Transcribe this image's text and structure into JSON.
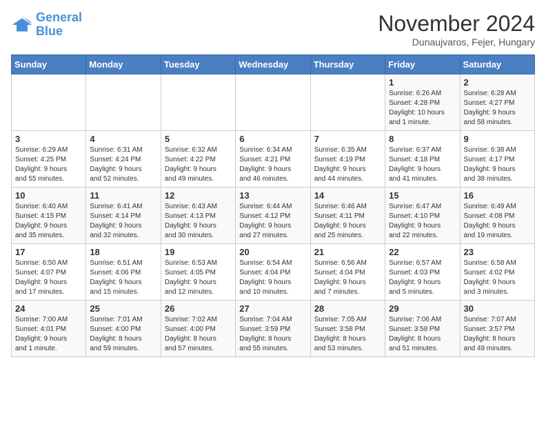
{
  "logo": {
    "line1": "General",
    "line2": "Blue"
  },
  "title": "November 2024",
  "subtitle": "Dunaujvaros, Fejer, Hungary",
  "days_header": [
    "Sunday",
    "Monday",
    "Tuesday",
    "Wednesday",
    "Thursday",
    "Friday",
    "Saturday"
  ],
  "weeks": [
    [
      {
        "day": "",
        "info": ""
      },
      {
        "day": "",
        "info": ""
      },
      {
        "day": "",
        "info": ""
      },
      {
        "day": "",
        "info": ""
      },
      {
        "day": "",
        "info": ""
      },
      {
        "day": "1",
        "info": "Sunrise: 6:26 AM\nSunset: 4:28 PM\nDaylight: 10 hours\nand 1 minute."
      },
      {
        "day": "2",
        "info": "Sunrise: 6:28 AM\nSunset: 4:27 PM\nDaylight: 9 hours\nand 58 minutes."
      }
    ],
    [
      {
        "day": "3",
        "info": "Sunrise: 6:29 AM\nSunset: 4:25 PM\nDaylight: 9 hours\nand 55 minutes."
      },
      {
        "day": "4",
        "info": "Sunrise: 6:31 AM\nSunset: 4:24 PM\nDaylight: 9 hours\nand 52 minutes."
      },
      {
        "day": "5",
        "info": "Sunrise: 6:32 AM\nSunset: 4:22 PM\nDaylight: 9 hours\nand 49 minutes."
      },
      {
        "day": "6",
        "info": "Sunrise: 6:34 AM\nSunset: 4:21 PM\nDaylight: 9 hours\nand 46 minutes."
      },
      {
        "day": "7",
        "info": "Sunrise: 6:35 AM\nSunset: 4:19 PM\nDaylight: 9 hours\nand 44 minutes."
      },
      {
        "day": "8",
        "info": "Sunrise: 6:37 AM\nSunset: 4:18 PM\nDaylight: 9 hours\nand 41 minutes."
      },
      {
        "day": "9",
        "info": "Sunrise: 6:38 AM\nSunset: 4:17 PM\nDaylight: 9 hours\nand 38 minutes."
      }
    ],
    [
      {
        "day": "10",
        "info": "Sunrise: 6:40 AM\nSunset: 4:15 PM\nDaylight: 9 hours\nand 35 minutes."
      },
      {
        "day": "11",
        "info": "Sunrise: 6:41 AM\nSunset: 4:14 PM\nDaylight: 9 hours\nand 32 minutes."
      },
      {
        "day": "12",
        "info": "Sunrise: 6:43 AM\nSunset: 4:13 PM\nDaylight: 9 hours\nand 30 minutes."
      },
      {
        "day": "13",
        "info": "Sunrise: 6:44 AM\nSunset: 4:12 PM\nDaylight: 9 hours\nand 27 minutes."
      },
      {
        "day": "14",
        "info": "Sunrise: 6:46 AM\nSunset: 4:11 PM\nDaylight: 9 hours\nand 25 minutes."
      },
      {
        "day": "15",
        "info": "Sunrise: 6:47 AM\nSunset: 4:10 PM\nDaylight: 9 hours\nand 22 minutes."
      },
      {
        "day": "16",
        "info": "Sunrise: 6:49 AM\nSunset: 4:08 PM\nDaylight: 9 hours\nand 19 minutes."
      }
    ],
    [
      {
        "day": "17",
        "info": "Sunrise: 6:50 AM\nSunset: 4:07 PM\nDaylight: 9 hours\nand 17 minutes."
      },
      {
        "day": "18",
        "info": "Sunrise: 6:51 AM\nSunset: 4:06 PM\nDaylight: 9 hours\nand 15 minutes."
      },
      {
        "day": "19",
        "info": "Sunrise: 6:53 AM\nSunset: 4:05 PM\nDaylight: 9 hours\nand 12 minutes."
      },
      {
        "day": "20",
        "info": "Sunrise: 6:54 AM\nSunset: 4:04 PM\nDaylight: 9 hours\nand 10 minutes."
      },
      {
        "day": "21",
        "info": "Sunrise: 6:56 AM\nSunset: 4:04 PM\nDaylight: 9 hours\nand 7 minutes."
      },
      {
        "day": "22",
        "info": "Sunrise: 6:57 AM\nSunset: 4:03 PM\nDaylight: 9 hours\nand 5 minutes."
      },
      {
        "day": "23",
        "info": "Sunrise: 6:58 AM\nSunset: 4:02 PM\nDaylight: 9 hours\nand 3 minutes."
      }
    ],
    [
      {
        "day": "24",
        "info": "Sunrise: 7:00 AM\nSunset: 4:01 PM\nDaylight: 9 hours\nand 1 minute."
      },
      {
        "day": "25",
        "info": "Sunrise: 7:01 AM\nSunset: 4:00 PM\nDaylight: 8 hours\nand 59 minutes."
      },
      {
        "day": "26",
        "info": "Sunrise: 7:02 AM\nSunset: 4:00 PM\nDaylight: 8 hours\nand 57 minutes."
      },
      {
        "day": "27",
        "info": "Sunrise: 7:04 AM\nSunset: 3:59 PM\nDaylight: 8 hours\nand 55 minutes."
      },
      {
        "day": "28",
        "info": "Sunrise: 7:05 AM\nSunset: 3:58 PM\nDaylight: 8 hours\nand 53 minutes."
      },
      {
        "day": "29",
        "info": "Sunrise: 7:06 AM\nSunset: 3:58 PM\nDaylight: 8 hours\nand 51 minutes."
      },
      {
        "day": "30",
        "info": "Sunrise: 7:07 AM\nSunset: 3:57 PM\nDaylight: 8 hours\nand 49 minutes."
      }
    ]
  ]
}
